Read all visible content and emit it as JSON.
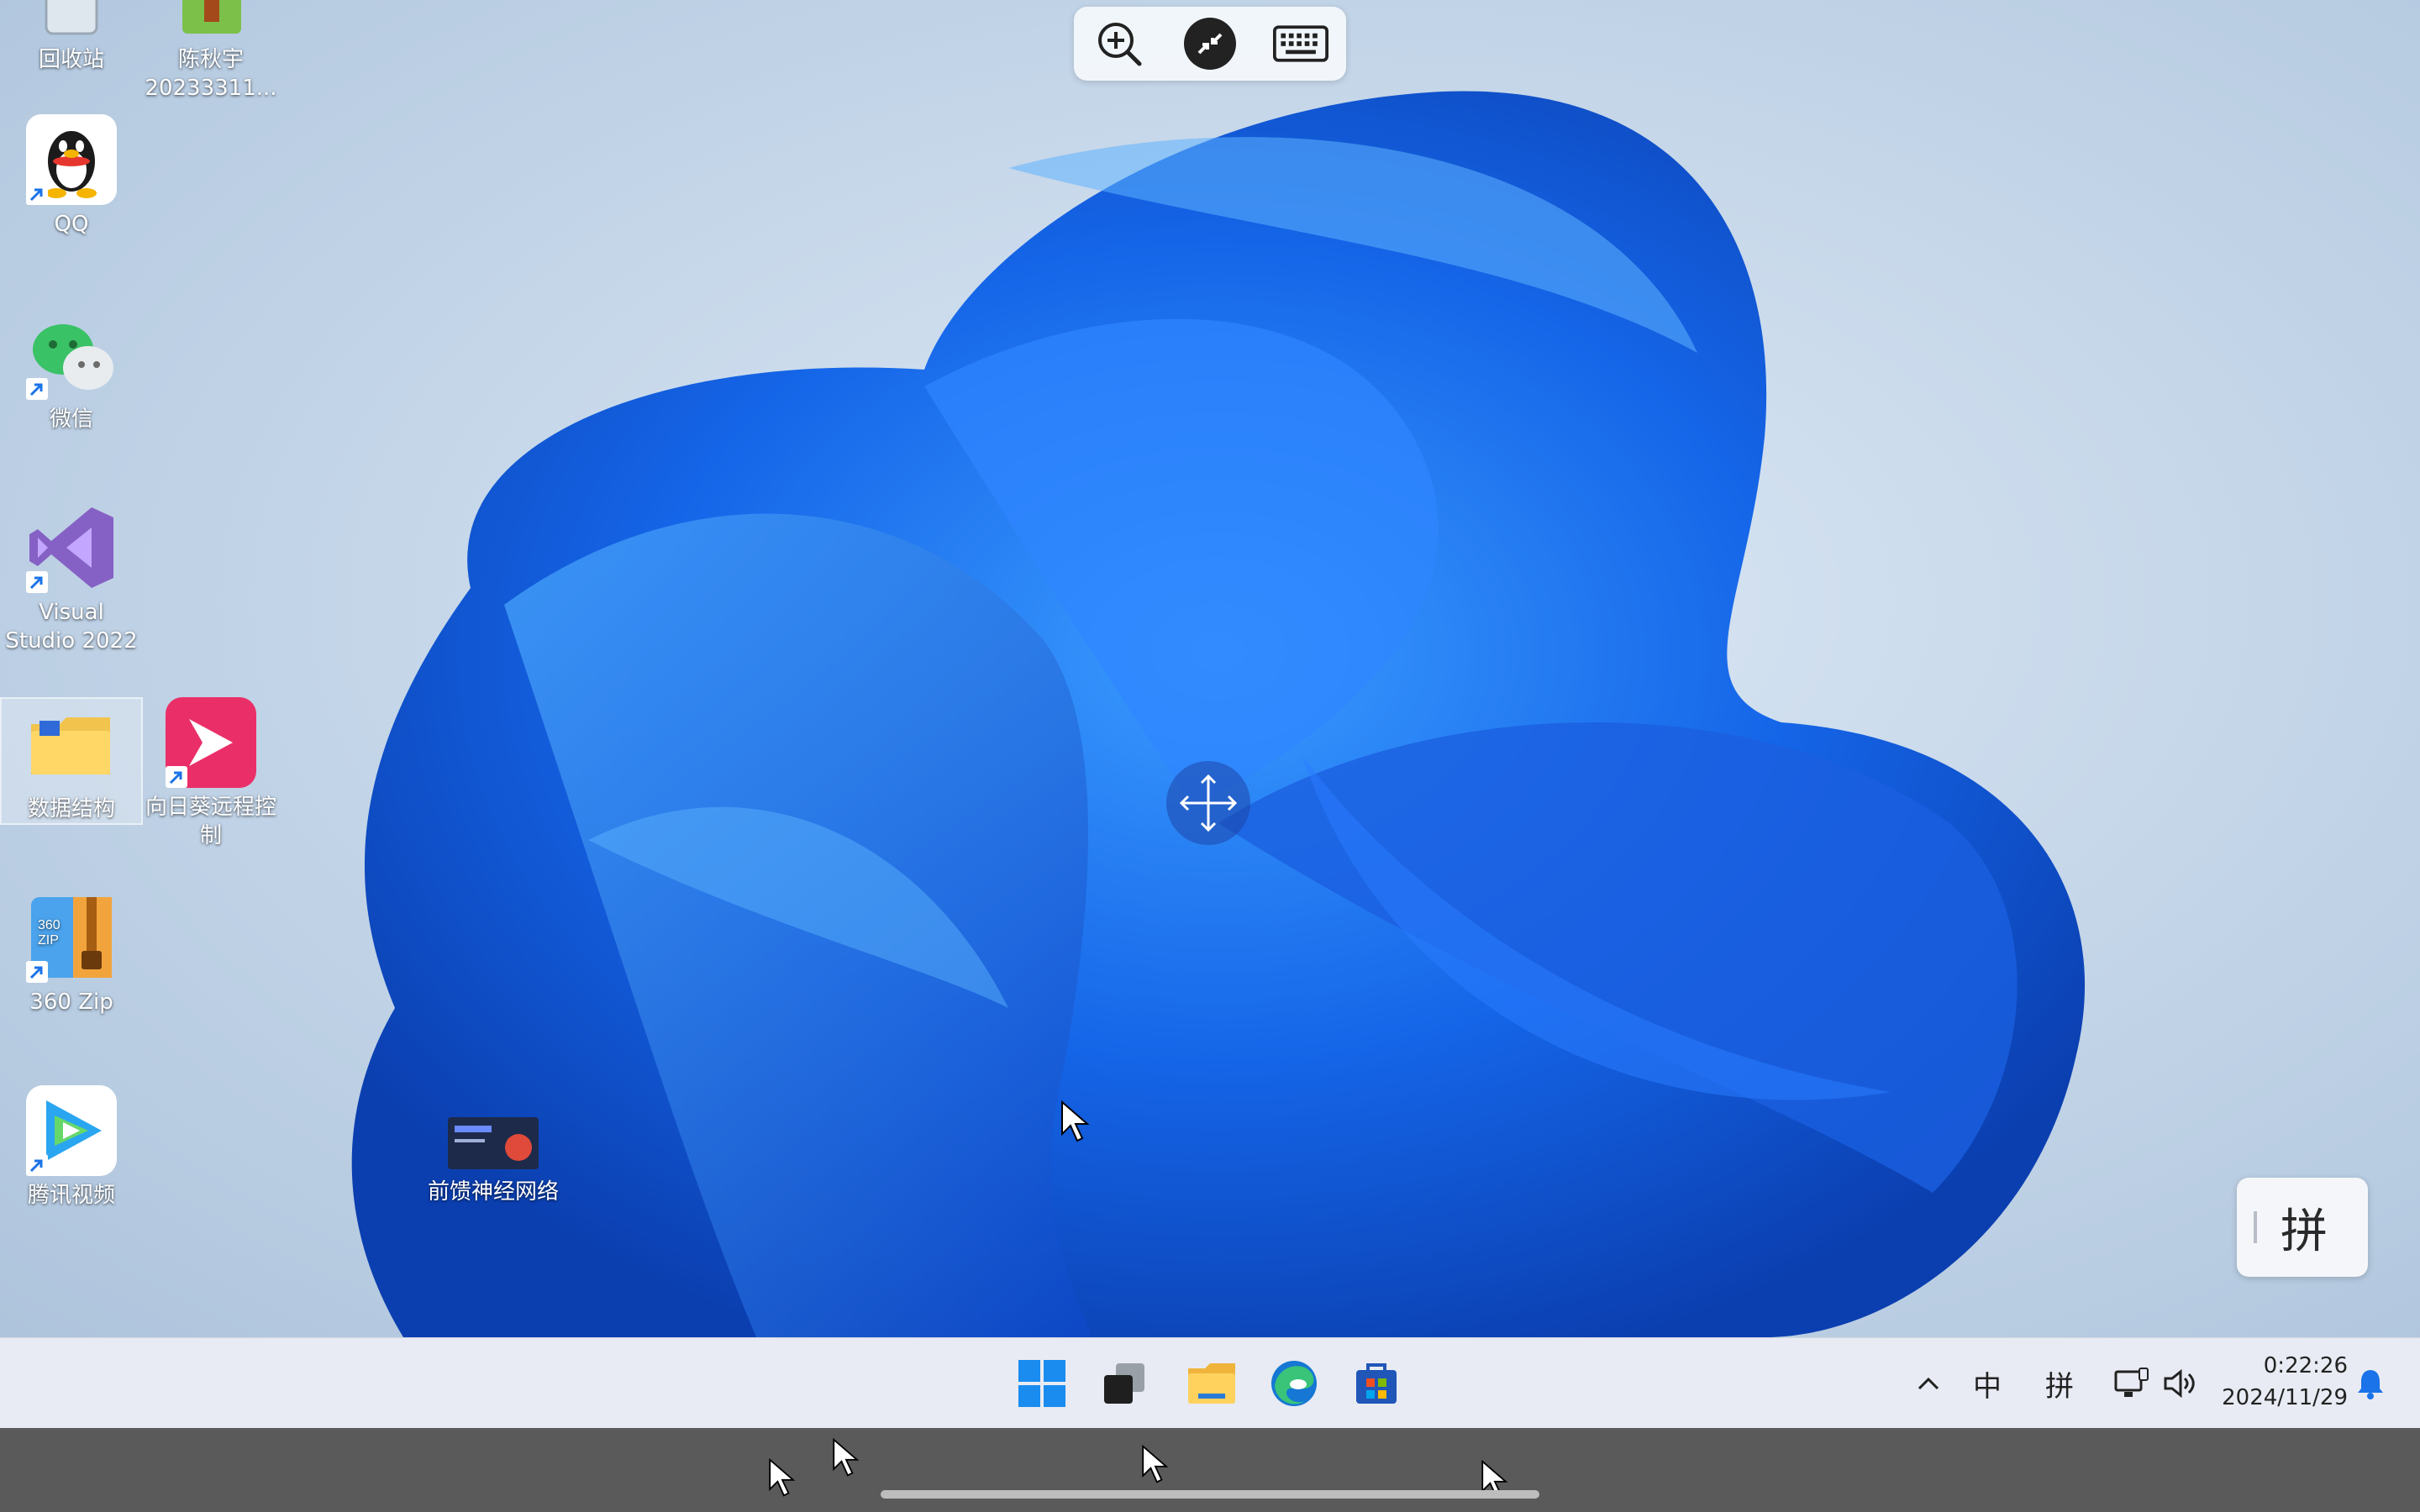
{
  "desktop": {
    "icons": [
      {
        "label": "回收站"
      },
      {
        "label": "陈秋宇\n20233311..."
      },
      {
        "label": "QQ"
      },
      {
        "label": "微信"
      },
      {
        "label": "Visual\nStudio 2022"
      },
      {
        "label": "数据结构"
      },
      {
        "label": "向日葵远程控\n制"
      },
      {
        "label": "360 Zip"
      },
      {
        "label": "腾讯视频"
      },
      {
        "label": "前馈神经网络"
      }
    ]
  },
  "remote_toolbar": {
    "items": [
      "zoom-icon",
      "remote-control-icon",
      "keyboard-icon"
    ]
  },
  "ime_float": {
    "label": "拼"
  },
  "taskbar": {
    "apps": [
      "windows-start-icon",
      "task-view-icon",
      "file-explorer-icon",
      "edge-icon",
      "store-icon"
    ],
    "tray": {
      "chevron": "^",
      "lang": "中",
      "ime": "拼"
    },
    "clock": {
      "time": "0:22:26",
      "date": "2024/11/29"
    }
  },
  "colors": {
    "wallpaper_blue": "#1565e8",
    "taskbar_bg": "#e8ebf3",
    "gesture_bg": "#5a5a5a"
  }
}
